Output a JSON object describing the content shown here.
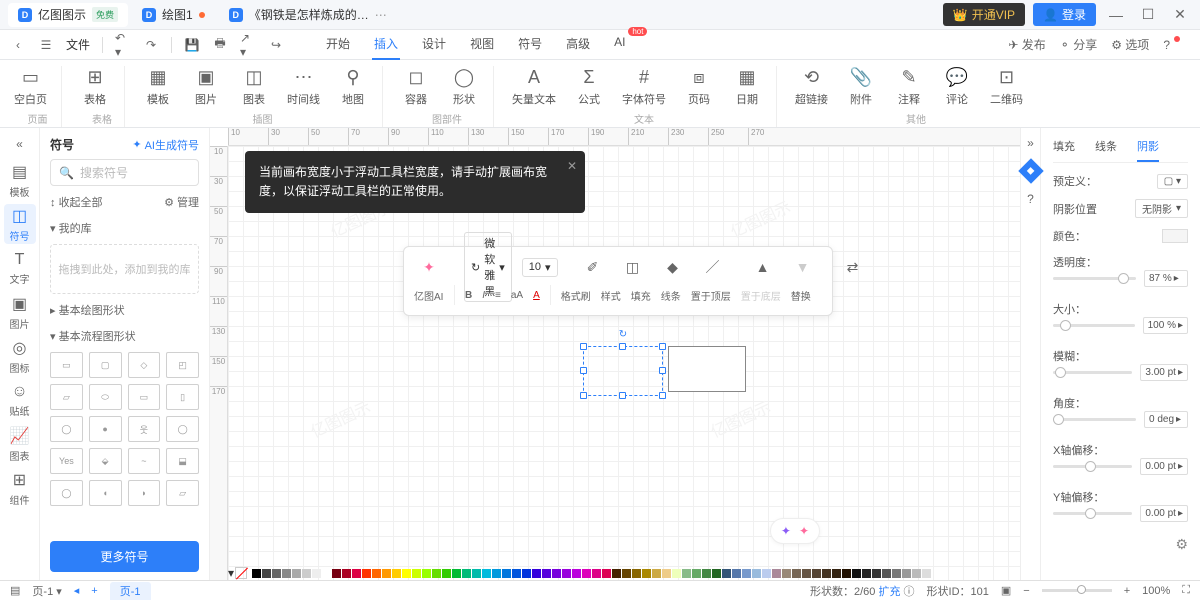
{
  "titlebar": {
    "app_name": "亿图图示",
    "free_badge": "免费",
    "tabs": [
      {
        "label": "绘图1",
        "dirty": true
      },
      {
        "label": "《钢铁是怎样炼成的…"
      }
    ],
    "vip": "开通VIP",
    "login": "登录"
  },
  "menubar": {
    "file": "文件",
    "tabs": [
      "开始",
      "插入",
      "设计",
      "视图",
      "符号",
      "高级",
      "AI"
    ],
    "active_tab": "插入",
    "hot": "hot",
    "publish": "发布",
    "share": "分享",
    "options": "选项"
  },
  "ribbon": {
    "groups": [
      {
        "label": "页面",
        "items": [
          {
            "l": "空白页",
            "i": "▭"
          }
        ]
      },
      {
        "label": "表格",
        "items": [
          {
            "l": "表格",
            "i": "⊞"
          }
        ]
      },
      {
        "label": "插图",
        "items": [
          {
            "l": "模板",
            "i": "▦"
          },
          {
            "l": "图片",
            "i": "▣"
          },
          {
            "l": "图表",
            "i": "◫"
          },
          {
            "l": "时间线",
            "i": "⋯"
          },
          {
            "l": "地图",
            "i": "⚲"
          }
        ]
      },
      {
        "label": "图部件",
        "items": [
          {
            "l": "容器",
            "i": "◻"
          },
          {
            "l": "形状",
            "i": "◯"
          }
        ]
      },
      {
        "label": "文本",
        "items": [
          {
            "l": "矢量文本",
            "i": "A"
          },
          {
            "l": "公式",
            "i": "Σ"
          },
          {
            "l": "字体符号",
            "i": "#"
          },
          {
            "l": "页码",
            "i": "⧈"
          },
          {
            "l": "日期",
            "i": "▦"
          }
        ]
      },
      {
        "label": "其他",
        "items": [
          {
            "l": "超链接",
            "i": "⟲"
          },
          {
            "l": "附件",
            "i": "📎"
          },
          {
            "l": "注释",
            "i": "✎"
          },
          {
            "l": "评论",
            "i": "💬"
          },
          {
            "l": "二维码",
            "i": "⊡"
          }
        ]
      }
    ]
  },
  "rail": [
    {
      "l": "模板",
      "i": "▤"
    },
    {
      "l": "符号",
      "i": "◫"
    },
    {
      "l": "文字",
      "i": "T"
    },
    {
      "l": "图片",
      "i": "▣"
    },
    {
      "l": "图标",
      "i": "◎"
    },
    {
      "l": "贴纸",
      "i": "☺"
    },
    {
      "l": "图表",
      "i": "📈"
    },
    {
      "l": "组件",
      "i": "⊞"
    }
  ],
  "panel": {
    "title": "符号",
    "ai_gen": "AI生成符号",
    "search_ph": "搜索符号",
    "collapse": "收起全部",
    "manage": "管理",
    "my_lib": "我的库",
    "drop_hint": "拖拽到此处，添加到我的库",
    "cat1": "基本绘图形状",
    "cat2": "基本流程图形状",
    "more": "更多符号"
  },
  "tooltip": "当前画布宽度小于浮动工具栏宽度，请手动扩展画布宽度，以保证浮动工具栏的正常使用。",
  "float_tb": {
    "ai": "亿图AI",
    "font": "微软雅黑",
    "size": "10",
    "row1": [
      {
        "l": "格式刷",
        "i": "✐"
      },
      {
        "l": "样式",
        "i": "◫"
      },
      {
        "l": "填充",
        "i": "◆"
      },
      {
        "l": "线条",
        "i": "／"
      },
      {
        "l": "置于顶层",
        "i": "▲"
      },
      {
        "l": "置于底层",
        "i": "▼"
      },
      {
        "l": "替换",
        "i": "⇄"
      }
    ]
  },
  "right": {
    "tabs": [
      "填充",
      "线条",
      "阴影"
    ],
    "preset": "预定义：",
    "pos": "阴影位置",
    "pos_v": "无阴影",
    "color": "颜色：",
    "opacity": "透明度：",
    "opacity_v": "87 %",
    "size": "大小：",
    "size_v": "100 %",
    "blur": "模糊：",
    "blur_v": "3.00 pt",
    "angle": "角度：",
    "angle_v": "0 deg",
    "xoff": "X轴偏移：",
    "xoff_v": "0.00 pt",
    "yoff": "Y轴偏移：",
    "yoff_v": "0.00 pt"
  },
  "ruler_h": [
    "10",
    "30",
    "50",
    "70",
    "90",
    "110",
    "130",
    "150",
    "170",
    "190",
    "210",
    "230",
    "250",
    "270"
  ],
  "ruler_v": [
    "10",
    "30",
    "50",
    "70",
    "90",
    "110",
    "130",
    "150",
    "170"
  ],
  "colors": [
    "#000",
    "#444",
    "#666",
    "#888",
    "#aaa",
    "#ccc",
    "#eee",
    "#fff",
    "#701",
    "#a02",
    "#d04",
    "#f30",
    "#f60",
    "#f90",
    "#fc0",
    "#ff0",
    "#cf0",
    "#9f0",
    "#6d0",
    "#3c0",
    "#0b3",
    "#0b7",
    "#0ba",
    "#0bd",
    "#09d",
    "#07d",
    "#05d",
    "#03d",
    "#30d",
    "#50d",
    "#70d",
    "#90d",
    "#b0d",
    "#d0b",
    "#d08",
    "#d05",
    "#420",
    "#640",
    "#860",
    "#a80",
    "#ca4",
    "#ec8",
    "#efb",
    "#8b8",
    "#6a6",
    "#484",
    "#262",
    "#357",
    "#57a",
    "#79c",
    "#9bd",
    "#bce",
    "#a89",
    "#987",
    "#765",
    "#654",
    "#543",
    "#432",
    "#321",
    "#210",
    "#111",
    "#222",
    "#333",
    "#555",
    "#777",
    "#999",
    "#bbb",
    "#ddd"
  ],
  "status": {
    "page_sel": "页-1",
    "page_tab": "页-1",
    "shapes": "形状数：2/60",
    "expand": "扩充",
    "shape_id": "形状ID：101",
    "zoom": "100%"
  }
}
